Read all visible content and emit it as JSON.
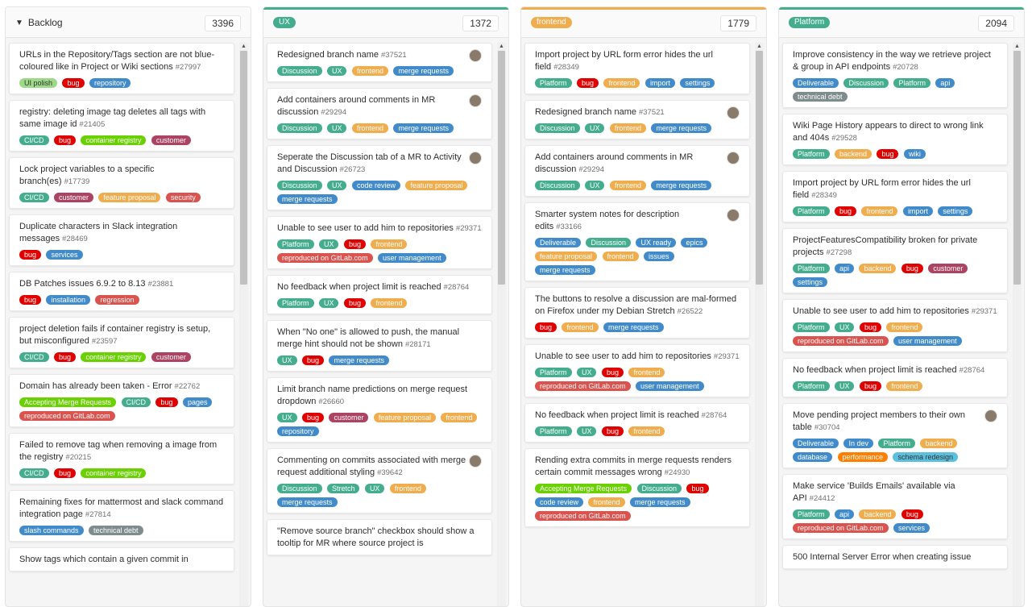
{
  "lists": [
    {
      "title": "Backlog",
      "type": "plain",
      "count": "3396",
      "cards": [
        {
          "title": "URLs in the Repository/Tags section are not blue-coloured like in Project or Wiki sections",
          "iid": "#27997",
          "labels": [
            {
              "t": "UI polish",
              "c": "#9dd987",
              "fg": "#333"
            },
            {
              "t": "bug",
              "c": "#e00000"
            },
            {
              "t": "repository",
              "c": "#428bca"
            }
          ]
        },
        {
          "title": "registry: deleting image tag deletes all tags with same image id",
          "iid": "#21405",
          "labels": [
            {
              "t": "CI/CD",
              "c": "#44ad8e"
            },
            {
              "t": "bug",
              "c": "#e00000"
            },
            {
              "t": "container registry",
              "c": "#69d100"
            },
            {
              "t": "customer",
              "c": "#ad4363"
            }
          ]
        },
        {
          "title": "Lock project variables to a specific branch(es)",
          "iid": "#17739",
          "labels": [
            {
              "t": "CI/CD",
              "c": "#44ad8e"
            },
            {
              "t": "customer",
              "c": "#ad4363"
            },
            {
              "t": "feature proposal",
              "c": "#f0ad4e"
            },
            {
              "t": "security",
              "c": "#d9534f"
            }
          ]
        },
        {
          "title": "Duplicate characters in Slack integration messages",
          "iid": "#28469",
          "labels": [
            {
              "t": "bug",
              "c": "#e00000"
            },
            {
              "t": "services",
              "c": "#428bca"
            }
          ]
        },
        {
          "title": "DB Patches issues 6.9.2 to 8.13",
          "iid": "#23881",
          "labels": [
            {
              "t": "bug",
              "c": "#e00000"
            },
            {
              "t": "installation",
              "c": "#428bca"
            },
            {
              "t": "regression",
              "c": "#d9534f"
            }
          ]
        },
        {
          "title": "project deletion fails if container registry is setup, but misconfigured",
          "iid": "#23597",
          "labels": [
            {
              "t": "CI/CD",
              "c": "#44ad8e"
            },
            {
              "t": "bug",
              "c": "#e00000"
            },
            {
              "t": "container registry",
              "c": "#69d100"
            },
            {
              "t": "customer",
              "c": "#ad4363"
            }
          ]
        },
        {
          "title": "Domain has already been taken - Error",
          "iid": "#22762",
          "labels": [
            {
              "t": "Accepting Merge Requests",
              "c": "#69d100"
            },
            {
              "t": "CI/CD",
              "c": "#44ad8e"
            },
            {
              "t": "bug",
              "c": "#e00000"
            },
            {
              "t": "pages",
              "c": "#428bca"
            },
            {
              "t": "reproduced on GitLab.com",
              "c": "#d9534f"
            }
          ]
        },
        {
          "title": "Failed to remove tag when removing a image from the registry",
          "iid": "#20215",
          "labels": [
            {
              "t": "CI/CD",
              "c": "#44ad8e"
            },
            {
              "t": "bug",
              "c": "#e00000"
            },
            {
              "t": "container registry",
              "c": "#69d100"
            }
          ]
        },
        {
          "title": "Remaining fixes for mattermost and slack command integration page",
          "iid": "#27814",
          "labels": [
            {
              "t": "slash commands",
              "c": "#428bca"
            },
            {
              "t": "technical debt",
              "c": "#7f8c8d"
            }
          ]
        },
        {
          "title": "Show tags which contain a given commit in",
          "iid": "",
          "labels": []
        }
      ]
    },
    {
      "title": "UX",
      "type": "label",
      "color": "#44ad8e",
      "count": "1372",
      "cards": [
        {
          "title": "Redesigned branch name",
          "iid": "#37521",
          "avatar": true,
          "labels": [
            {
              "t": "Discussion",
              "c": "#44ad8e"
            },
            {
              "t": "UX",
              "c": "#44ad8e"
            },
            {
              "t": "frontend",
              "c": "#f0ad4e"
            },
            {
              "t": "merge requests",
              "c": "#428bca"
            }
          ]
        },
        {
          "title": "Add containers around comments in MR discussion",
          "iid": "#29294",
          "avatar": true,
          "labels": [
            {
              "t": "Discussion",
              "c": "#44ad8e"
            },
            {
              "t": "UX",
              "c": "#44ad8e"
            },
            {
              "t": "frontend",
              "c": "#f0ad4e"
            },
            {
              "t": "merge requests",
              "c": "#428bca"
            }
          ]
        },
        {
          "title": "Seperate the Discussion tab of a MR to Activity and Discussion",
          "iid": "#26723",
          "avatar": true,
          "labels": [
            {
              "t": "Discussion",
              "c": "#44ad8e"
            },
            {
              "t": "UX",
              "c": "#44ad8e"
            },
            {
              "t": "code review",
              "c": "#428bca"
            },
            {
              "t": "feature proposal",
              "c": "#f0ad4e"
            },
            {
              "t": "merge requests",
              "c": "#428bca"
            }
          ]
        },
        {
          "title": "Unable to see user to add him to repositories",
          "iid": "#29371",
          "labels": [
            {
              "t": "Platform",
              "c": "#44ad8e"
            },
            {
              "t": "UX",
              "c": "#44ad8e"
            },
            {
              "t": "bug",
              "c": "#e00000"
            },
            {
              "t": "frontend",
              "c": "#f0ad4e"
            },
            {
              "t": "reproduced on GitLab.com",
              "c": "#d9534f"
            },
            {
              "t": "user management",
              "c": "#428bca"
            }
          ]
        },
        {
          "title": "No feedback when project limit is reached",
          "iid": "#28764",
          "labels": [
            {
              "t": "Platform",
              "c": "#44ad8e"
            },
            {
              "t": "UX",
              "c": "#44ad8e"
            },
            {
              "t": "bug",
              "c": "#e00000"
            },
            {
              "t": "frontend",
              "c": "#f0ad4e"
            }
          ]
        },
        {
          "title": "When \"No one\" is allowed to push, the manual merge hint should not be shown",
          "iid": "#28171",
          "labels": [
            {
              "t": "UX",
              "c": "#44ad8e"
            },
            {
              "t": "bug",
              "c": "#e00000"
            },
            {
              "t": "merge requests",
              "c": "#428bca"
            }
          ]
        },
        {
          "title": "Limit branch name predictions on merge request dropdown",
          "iid": "#26660",
          "labels": [
            {
              "t": "UX",
              "c": "#44ad8e"
            },
            {
              "t": "bug",
              "c": "#e00000"
            },
            {
              "t": "customer",
              "c": "#ad4363"
            },
            {
              "t": "feature proposal",
              "c": "#f0ad4e"
            },
            {
              "t": "frontend",
              "c": "#f0ad4e"
            },
            {
              "t": "repository",
              "c": "#428bca"
            }
          ]
        },
        {
          "title": "Commenting on commits associated with merge request additional styling",
          "iid": "#39642",
          "avatar": true,
          "labels": [
            {
              "t": "Discussion",
              "c": "#44ad8e"
            },
            {
              "t": "Stretch",
              "c": "#44ad8e"
            },
            {
              "t": "UX",
              "c": "#44ad8e"
            },
            {
              "t": "frontend",
              "c": "#f0ad4e"
            },
            {
              "t": "merge requests",
              "c": "#428bca"
            }
          ]
        },
        {
          "title": "\"Remove source branch\" checkbox should show a tooltip for MR where source project is",
          "iid": "",
          "labels": []
        }
      ]
    },
    {
      "title": "frontend",
      "type": "label",
      "color": "#f0ad4e",
      "count": "1779",
      "cards": [
        {
          "title": "Import project by URL form error hides the url field",
          "iid": "#28349",
          "labels": [
            {
              "t": "Platform",
              "c": "#44ad8e"
            },
            {
              "t": "bug",
              "c": "#e00000"
            },
            {
              "t": "frontend",
              "c": "#f0ad4e"
            },
            {
              "t": "import",
              "c": "#428bca"
            },
            {
              "t": "settings",
              "c": "#428bca"
            }
          ]
        },
        {
          "title": "Redesigned branch name",
          "iid": "#37521",
          "avatar": true,
          "labels": [
            {
              "t": "Discussion",
              "c": "#44ad8e"
            },
            {
              "t": "UX",
              "c": "#44ad8e"
            },
            {
              "t": "frontend",
              "c": "#f0ad4e"
            },
            {
              "t": "merge requests",
              "c": "#428bca"
            }
          ]
        },
        {
          "title": "Add containers around comments in MR discussion",
          "iid": "#29294",
          "avatar": true,
          "labels": [
            {
              "t": "Discussion",
              "c": "#44ad8e"
            },
            {
              "t": "UX",
              "c": "#44ad8e"
            },
            {
              "t": "frontend",
              "c": "#f0ad4e"
            },
            {
              "t": "merge requests",
              "c": "#428bca"
            }
          ]
        },
        {
          "title": "Smarter system notes for description edits",
          "iid": "#33166",
          "avatar": true,
          "labels": [
            {
              "t": "Deliverable",
              "c": "#428bca"
            },
            {
              "t": "Discussion",
              "c": "#44ad8e"
            },
            {
              "t": "UX ready",
              "c": "#428bca"
            },
            {
              "t": "epics",
              "c": "#428bca"
            },
            {
              "t": "feature proposal",
              "c": "#f0ad4e"
            },
            {
              "t": "frontend",
              "c": "#f0ad4e"
            },
            {
              "t": "issues",
              "c": "#428bca"
            },
            {
              "t": "merge requests",
              "c": "#428bca"
            }
          ]
        },
        {
          "title": "The buttons to resolve a discussion are mal-formed on Firefox under my Debian Stretch",
          "iid": "#26522",
          "labels": [
            {
              "t": "bug",
              "c": "#e00000"
            },
            {
              "t": "frontend",
              "c": "#f0ad4e"
            },
            {
              "t": "merge requests",
              "c": "#428bca"
            }
          ]
        },
        {
          "title": "Unable to see user to add him to repositories",
          "iid": "#29371",
          "labels": [
            {
              "t": "Platform",
              "c": "#44ad8e"
            },
            {
              "t": "UX",
              "c": "#44ad8e"
            },
            {
              "t": "bug",
              "c": "#e00000"
            },
            {
              "t": "frontend",
              "c": "#f0ad4e"
            },
            {
              "t": "reproduced on GitLab.com",
              "c": "#d9534f"
            },
            {
              "t": "user management",
              "c": "#428bca"
            }
          ]
        },
        {
          "title": "No feedback when project limit is reached",
          "iid": "#28764",
          "labels": [
            {
              "t": "Platform",
              "c": "#44ad8e"
            },
            {
              "t": "UX",
              "c": "#44ad8e"
            },
            {
              "t": "bug",
              "c": "#e00000"
            },
            {
              "t": "frontend",
              "c": "#f0ad4e"
            }
          ]
        },
        {
          "title": "Rending extra commits in merge requests renders certain commit messages wrong",
          "iid": "#24930",
          "labels": [
            {
              "t": "Accepting Merge Requests",
              "c": "#69d100"
            },
            {
              "t": "Discussion",
              "c": "#44ad8e"
            },
            {
              "t": "bug",
              "c": "#e00000"
            },
            {
              "t": "code review",
              "c": "#428bca"
            },
            {
              "t": "frontend",
              "c": "#f0ad4e"
            },
            {
              "t": "merge requests",
              "c": "#428bca"
            },
            {
              "t": "reproduced on GitLab.com",
              "c": "#d9534f"
            }
          ]
        }
      ]
    },
    {
      "title": "Platform",
      "type": "label",
      "color": "#44ad8e",
      "count": "2094",
      "cards": [
        {
          "title": "Improve consistency in the way we retrieve project & group in API endpoints",
          "iid": "#20728",
          "labels": [
            {
              "t": "Deliverable",
              "c": "#428bca"
            },
            {
              "t": "Discussion",
              "c": "#44ad8e"
            },
            {
              "t": "Platform",
              "c": "#44ad8e"
            },
            {
              "t": "api",
              "c": "#428bca"
            },
            {
              "t": "technical debt",
              "c": "#7f8c8d"
            }
          ]
        },
        {
          "title": "Wiki Page History appears to direct to wrong link and 404s",
          "iid": "#29528",
          "labels": [
            {
              "t": "Platform",
              "c": "#44ad8e"
            },
            {
              "t": "backend",
              "c": "#f0ad4e"
            },
            {
              "t": "bug",
              "c": "#e00000"
            },
            {
              "t": "wiki",
              "c": "#428bca"
            }
          ]
        },
        {
          "title": "Import project by URL form error hides the url field",
          "iid": "#28349",
          "labels": [
            {
              "t": "Platform",
              "c": "#44ad8e"
            },
            {
              "t": "bug",
              "c": "#e00000"
            },
            {
              "t": "frontend",
              "c": "#f0ad4e"
            },
            {
              "t": "import",
              "c": "#428bca"
            },
            {
              "t": "settings",
              "c": "#428bca"
            }
          ]
        },
        {
          "title": "ProjectFeaturesCompatibility broken for private projects",
          "iid": "#27298",
          "labels": [
            {
              "t": "Platform",
              "c": "#44ad8e"
            },
            {
              "t": "api",
              "c": "#428bca"
            },
            {
              "t": "backend",
              "c": "#f0ad4e"
            },
            {
              "t": "bug",
              "c": "#e00000"
            },
            {
              "t": "customer",
              "c": "#ad4363"
            },
            {
              "t": "settings",
              "c": "#428bca"
            }
          ]
        },
        {
          "title": "Unable to see user to add him to repositories",
          "iid": "#29371",
          "labels": [
            {
              "t": "Platform",
              "c": "#44ad8e"
            },
            {
              "t": "UX",
              "c": "#44ad8e"
            },
            {
              "t": "bug",
              "c": "#e00000"
            },
            {
              "t": "frontend",
              "c": "#f0ad4e"
            },
            {
              "t": "reproduced on GitLab.com",
              "c": "#d9534f"
            },
            {
              "t": "user management",
              "c": "#428bca"
            }
          ]
        },
        {
          "title": "No feedback when project limit is reached",
          "iid": "#28764",
          "labels": [
            {
              "t": "Platform",
              "c": "#44ad8e"
            },
            {
              "t": "UX",
              "c": "#44ad8e"
            },
            {
              "t": "bug",
              "c": "#e00000"
            },
            {
              "t": "frontend",
              "c": "#f0ad4e"
            }
          ]
        },
        {
          "title": "Move pending project members to their own table",
          "iid": "#30704",
          "avatar": true,
          "labels": [
            {
              "t": "Deliverable",
              "c": "#428bca"
            },
            {
              "t": "In dev",
              "c": "#428bca"
            },
            {
              "t": "Platform",
              "c": "#44ad8e"
            },
            {
              "t": "backend",
              "c": "#f0ad4e"
            },
            {
              "t": "database",
              "c": "#428bca"
            },
            {
              "t": "performance",
              "c": "#ff7f00"
            },
            {
              "t": "schema redesign",
              "c": "#5bc0de",
              "fg": "#333"
            }
          ]
        },
        {
          "title": "Make service 'Builds Emails' available via API",
          "iid": "#24412",
          "labels": [
            {
              "t": "Platform",
              "c": "#44ad8e"
            },
            {
              "t": "api",
              "c": "#428bca"
            },
            {
              "t": "backend",
              "c": "#f0ad4e"
            },
            {
              "t": "bug",
              "c": "#e00000"
            },
            {
              "t": "reproduced on GitLab.com",
              "c": "#d9534f"
            },
            {
              "t": "services",
              "c": "#428bca"
            }
          ]
        },
        {
          "title": "500 Internal Server Error when creating issue",
          "iid": "",
          "labels": []
        }
      ]
    }
  ]
}
